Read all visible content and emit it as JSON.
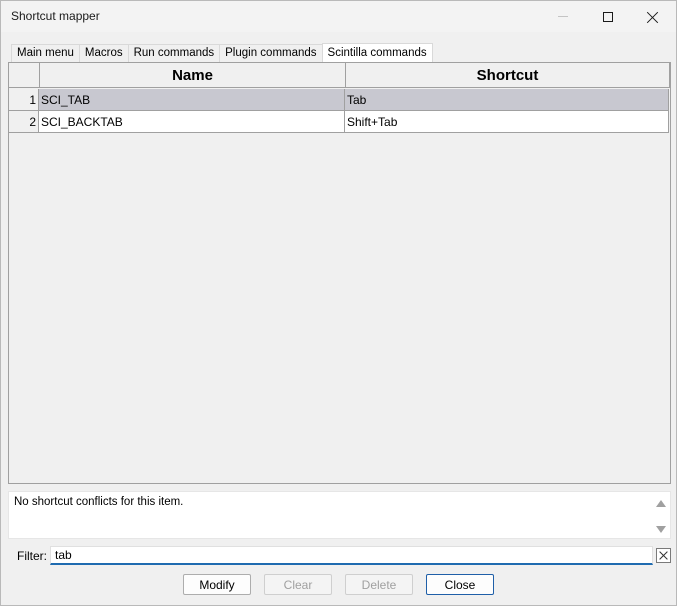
{
  "window": {
    "title": "Shortcut mapper"
  },
  "tabs": [
    {
      "label": "Main menu",
      "active": false
    },
    {
      "label": "Macros",
      "active": false
    },
    {
      "label": "Run commands",
      "active": false
    },
    {
      "label": "Plugin commands",
      "active": false
    },
    {
      "label": "Scintilla commands",
      "active": true
    }
  ],
  "grid": {
    "columns": [
      "Name",
      "Shortcut"
    ],
    "rows": [
      {
        "num": "1",
        "name": "SCI_TAB",
        "shortcut": "Tab",
        "selected": true
      },
      {
        "num": "2",
        "name": "SCI_BACKTAB",
        "shortcut": "Shift+Tab",
        "selected": false
      }
    ]
  },
  "conflict": {
    "text": "No shortcut conflicts for this item."
  },
  "filter": {
    "label": "Filter:",
    "value": "tab"
  },
  "buttons": {
    "modify": "Modify",
    "clear": "Clear",
    "delete": "Delete",
    "close": "Close"
  },
  "colors": {
    "selection": "#c8c8d0",
    "focus_underline": "#1f6bb0",
    "default_button_border": "#1f5fa8"
  }
}
